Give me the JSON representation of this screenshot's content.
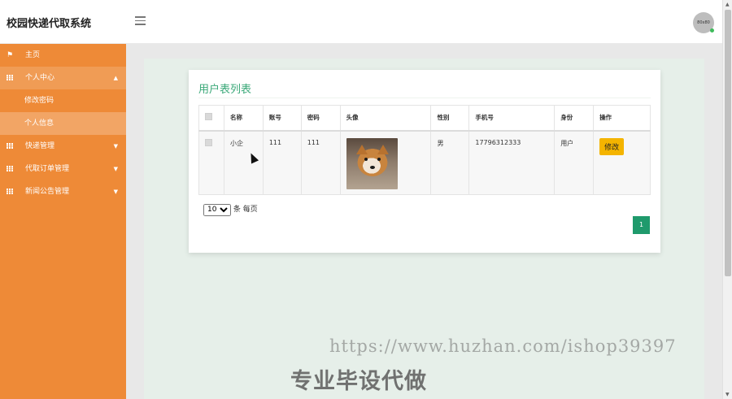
{
  "app": {
    "title": "校园快递代取系统",
    "avatar_text": "80x80"
  },
  "sidebar": {
    "items": [
      {
        "label": "主页",
        "icon": "flag-icon",
        "active": false
      },
      {
        "label": "个人中心",
        "icon": "grid-icon",
        "expanded": true,
        "active": true
      },
      {
        "label": "修改密码",
        "sub": true,
        "active": false
      },
      {
        "label": "个人信息",
        "sub": true,
        "active": true
      },
      {
        "label": "快递管理",
        "icon": "grid-icon",
        "expanded": false
      },
      {
        "label": "代取订单管理",
        "icon": "grid-icon",
        "expanded": false
      },
      {
        "label": "新闻公告管理",
        "icon": "grid-icon",
        "expanded": false
      }
    ]
  },
  "card": {
    "title": "用户表列表"
  },
  "table": {
    "headers": [
      "名称",
      "账号",
      "密码",
      "头像",
      "性别",
      "手机号",
      "身份",
      "操作"
    ],
    "rows": [
      {
        "name": "小企",
        "account": "111",
        "password": "111",
        "gender": "男",
        "phone": "17796312333",
        "role": "用户",
        "action": "修改"
      }
    ]
  },
  "pagination": {
    "page_size": "10",
    "page_size_suffix": "条 每页",
    "current_page": "1"
  },
  "watermark": {
    "url": "https://www.huzhan.com/ishop39397",
    "slogan": "专业毕设代做"
  },
  "colors": {
    "sidebar": "#ee8a37",
    "accent_green": "#3aa878",
    "edit_button": "#f4b400",
    "page_button": "#1f9a6c"
  }
}
